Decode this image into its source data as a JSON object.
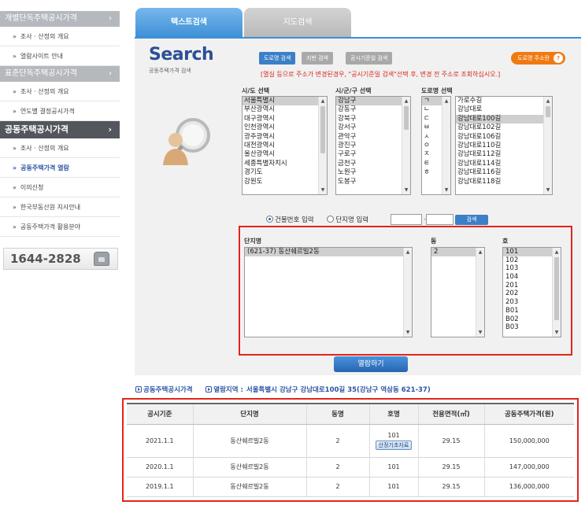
{
  "sidebar": {
    "sections": [
      {
        "title": "개별단독주택공시가격",
        "arrow": "›",
        "items": [
          "조사 · 산정의 개요",
          "열람사이트 안내"
        ]
      },
      {
        "title": "표준단독주택공시가격",
        "arrow": "›",
        "items": [
          "조사 · 산정의 개요",
          "연도별 결정공시가격"
        ]
      },
      {
        "title": "공동주택공시가격",
        "arrow": "›",
        "items": [
          "조사 · 산정의 개요",
          "공동주택가격 열람",
          "이의신청",
          "한국부동산원 지사안내",
          "공동주택가격 활용분야"
        ]
      }
    ],
    "bullet": "»",
    "active_item": "공동주택가격 열람",
    "phone": "1644-2828"
  },
  "tabs": {
    "text_search": "텍스트검색",
    "map_search": "지도검색"
  },
  "search": {
    "title": "Search",
    "subtitle": "공동주택가격 검색",
    "modes": {
      "road": "도로명 검색",
      "lot": "지번 검색",
      "notice": "공시기준일 검색"
    },
    "road_info": "도로명 주소란",
    "road_info_icon": "?",
    "warning": "[멸실 등으로 주소가 변경된경우, \"공시기준일 검색\"선택 후, 변경 전 주소로 조회하십시오.]",
    "city_label": "시/도 선택",
    "cities": [
      "서울특별시",
      "부산광역시",
      "대구광역시",
      "인천광역시",
      "광주광역시",
      "대전광역시",
      "울산광역시",
      "세종특별자치시",
      "경기도",
      "강원도"
    ],
    "district_label": "시/군/구 선택",
    "districts": [
      "강남구",
      "강동구",
      "강북구",
      "강서구",
      "관악구",
      "광진구",
      "구로구",
      "금천구",
      "노원구",
      "도봉구"
    ],
    "road_label": "도로명 선택",
    "initials": [
      "ㄱ",
      "ㄴ",
      "ㄷ",
      "ㅂ",
      "ㅅ",
      "ㅇ",
      "ㅈ",
      "ㅌ",
      "ㅎ"
    ],
    "roads": [
      "가로수길",
      "강남대로",
      "강남대로100길",
      "강남대로102길",
      "강남대로106길",
      "강남대로110길",
      "강남대로112길",
      "강남대로114길",
      "강남대로116길",
      "강남대로118길"
    ],
    "radio_building": "건물번호 입력",
    "radio_complex": "단지명 입력",
    "dash": "-",
    "search_button": "검색",
    "complex_label": "단지명",
    "complexes": [
      "(621-37) 동산쉐르빌2동"
    ],
    "dong_label": "동",
    "dongs": [
      "2"
    ],
    "ho_label": "호",
    "hos": [
      "101",
      "102",
      "103",
      "104",
      "201",
      "202",
      "203",
      "B01",
      "B02",
      "B03"
    ],
    "view_button": "열람하기"
  },
  "info": {
    "label": "공동주택공시가격",
    "area_label": "열람지역 :",
    "area_value": "서울특별시 강남구 강남대로100길 35(강남구 역삼동 621-37)"
  },
  "table": {
    "headers": [
      "공시기준",
      "단지명",
      "동명",
      "호명",
      "전용면적(㎡)",
      "공동주택가격(원)"
    ],
    "rows": [
      {
        "date": "2021.1.1",
        "complex": "동산쉐르빌2동",
        "dong": "2",
        "ho": "101",
        "area": "29.15",
        "price": "150,000,000",
        "button": "산정기초자료"
      },
      {
        "date": "2020.1.1",
        "complex": "동산쉐르빌2동",
        "dong": "2",
        "ho": "101",
        "area": "29.15",
        "price": "147,000,000"
      },
      {
        "date": "2019.1.1",
        "complex": "동산쉐르빌2동",
        "dong": "2",
        "ho": "101",
        "area": "29.15",
        "price": "136,000,000"
      }
    ]
  }
}
